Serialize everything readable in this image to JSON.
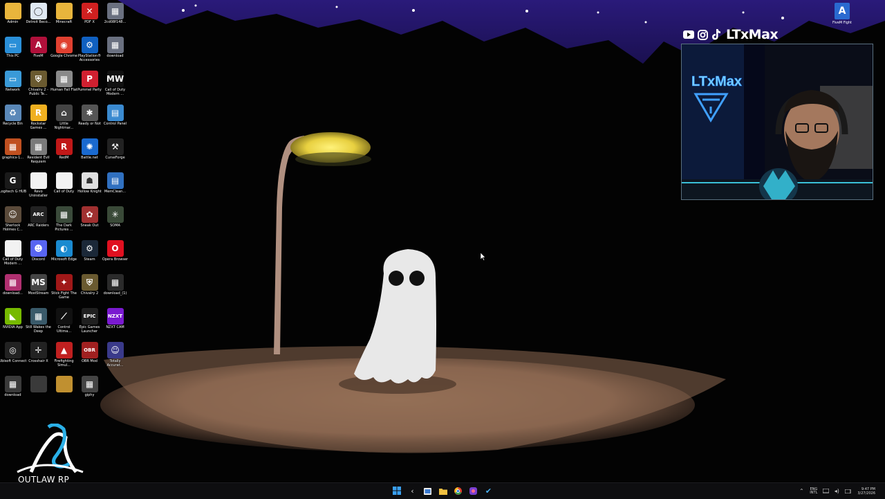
{
  "desktop": {
    "icons": [
      {
        "label": "Admin",
        "icon": "folder-icon",
        "color": "#e8b53c",
        "glyph": ""
      },
      {
        "label": "Detroit Beco...",
        "icon": "detroit-icon",
        "color": "#dfe8f2",
        "glyph": "◯"
      },
      {
        "label": "Minecraft",
        "icon": "folder-icon",
        "color": "#e8b53c",
        "glyph": ""
      },
      {
        "label": "PDF X",
        "icon": "pdf-icon",
        "color": "#d02020",
        "glyph": "✕"
      },
      {
        "label": "2cd08f148...",
        "icon": "image-file-icon",
        "color": "#6a7080",
        "glyph": "▦"
      },
      {
        "label": "This PC",
        "icon": "this-pc-icon",
        "color": "#2a8fd8",
        "glyph": "▭"
      },
      {
        "label": "FiveM",
        "icon": "fivem-icon",
        "color": "#b0103a",
        "glyph": "A"
      },
      {
        "label": "Google Chrome",
        "icon": "chrome-icon",
        "color": "#e04030",
        "glyph": "◉"
      },
      {
        "label": "PlayStation® Accessories",
        "icon": "playstation-icon",
        "color": "#1060c0",
        "glyph": "⚙"
      },
      {
        "label": "download",
        "icon": "image-file-icon",
        "color": "#6a7080",
        "glyph": "▦"
      },
      {
        "label": "Network",
        "icon": "network-icon",
        "color": "#3a9ad8",
        "glyph": "▭"
      },
      {
        "label": "Chivalry 2 - Public Te...",
        "icon": "chivalry-icon",
        "color": "#6a5a30",
        "glyph": "⛨"
      },
      {
        "label": "Human Fall Flat",
        "icon": "human-fall-flat-icon",
        "color": "#8a8a8a",
        "glyph": "▦"
      },
      {
        "label": "Pummel Party",
        "icon": "pummel-party-icon",
        "color": "#d02030",
        "glyph": "P"
      },
      {
        "label": "Call of Duty Modern ...",
        "icon": "mw-icon",
        "color": "#111111",
        "glyph": "MW"
      },
      {
        "label": "Recycle Bin",
        "icon": "recycle-bin-icon",
        "color": "#5a88b8",
        "glyph": "♻"
      },
      {
        "label": "Rockstar Games ...",
        "icon": "rockstar-icon",
        "color": "#f0b020",
        "glyph": "R"
      },
      {
        "label": "Little Nightmar...",
        "icon": "little-nightmares-icon",
        "color": "#444444",
        "glyph": "⌂"
      },
      {
        "label": "Ready or Not",
        "icon": "ready-or-not-icon",
        "color": "#555555",
        "glyph": "✱"
      },
      {
        "label": "Control Panel",
        "icon": "control-panel-icon",
        "color": "#3a8ad0",
        "glyph": "▤"
      },
      {
        "label": "graphics-1...",
        "icon": "image-file-icon",
        "color": "#c05020",
        "glyph": "▦"
      },
      {
        "label": "Resident Evil Requiem",
        "icon": "resident-evil-icon",
        "color": "#7a7a7a",
        "glyph": "▦"
      },
      {
        "label": "RedM",
        "icon": "redm-icon",
        "color": "#c01818",
        "glyph": "R"
      },
      {
        "label": "Battle.net",
        "icon": "battlenet-icon",
        "color": "#1a6ad0",
        "glyph": "✺"
      },
      {
        "label": "CurseForge",
        "icon": "curseforge-icon",
        "color": "#222222",
        "glyph": "⚒"
      },
      {
        "label": "Logitech G HUB",
        "icon": "logitech-icon",
        "color": "#1a1a1a",
        "glyph": "G"
      },
      {
        "label": "Revo Uninstaller",
        "icon": "file-icon",
        "color": "#f2f2f2",
        "glyph": ""
      },
      {
        "label": "Call of Duty",
        "icon": "file-icon",
        "color": "#f2f2f2",
        "glyph": ""
      },
      {
        "label": "Hollow Knight",
        "icon": "hollow-knight-icon",
        "color": "#e0e0e0",
        "glyph": "☗"
      },
      {
        "label": "MemClean...",
        "icon": "memclean-icon",
        "color": "#3070c0",
        "glyph": "▤"
      },
      {
        "label": "Sherlock Holmes C...",
        "icon": "sherlock-icon",
        "color": "#5a4a3a",
        "glyph": "☺"
      },
      {
        "label": "ARC Raiders",
        "icon": "arc-raiders-icon",
        "color": "#222222",
        "glyph": "ARC"
      },
      {
        "label": "The Dark Pictures ...",
        "icon": "dark-pictures-icon",
        "color": "#3a4a3a",
        "glyph": "▦"
      },
      {
        "label": "Sneak Out",
        "icon": "sneak-out-icon",
        "color": "#a03030",
        "glyph": "✿"
      },
      {
        "label": "SOMA",
        "icon": "soma-icon",
        "color": "#3a4a38",
        "glyph": "✳"
      },
      {
        "label": "Call of Duty Modern ...",
        "icon": "file-icon",
        "color": "#f2f2f2",
        "glyph": ""
      },
      {
        "label": "Discord",
        "icon": "discord-icon",
        "color": "#5865f2",
        "glyph": "☻"
      },
      {
        "label": "Microsoft Edge",
        "icon": "edge-icon",
        "color": "#1a8ad0",
        "glyph": "◐"
      },
      {
        "label": "Steam",
        "icon": "steam-icon",
        "color": "#1b2838",
        "glyph": "⚙"
      },
      {
        "label": "Opera Browser",
        "icon": "opera-icon",
        "color": "#e01020",
        "glyph": "O"
      },
      {
        "label": "download...",
        "icon": "image-file-icon",
        "color": "#b03070",
        "glyph": "▦"
      },
      {
        "label": "MostStream",
        "icon": "moststream-icon",
        "color": "#444444",
        "glyph": "MS"
      },
      {
        "label": "Stick Fight The Game",
        "icon": "stick-fight-icon",
        "color": "#a01818",
        "glyph": "✦"
      },
      {
        "label": "Chivalry 2",
        "icon": "chivalry-icon",
        "color": "#6a5a30",
        "glyph": "⛨"
      },
      {
        "label": "download_(1)",
        "icon": "image-file-icon",
        "color": "#2a2a2a",
        "glyph": "▦"
      },
      {
        "label": "NVIDIA App",
        "icon": "nvidia-icon",
        "color": "#76b900",
        "glyph": "◣"
      },
      {
        "label": "Still Wakes the Deep",
        "icon": "still-wakes-icon",
        "color": "#3a5a6a",
        "glyph": "▦"
      },
      {
        "label": "Control Ultima...",
        "icon": "control-icon",
        "color": "#111111",
        "glyph": "⟋"
      },
      {
        "label": "Epic Games Launcher",
        "icon": "epic-games-icon",
        "color": "#202020",
        "glyph": "EPIC"
      },
      {
        "label": "NZXT CAM",
        "icon": "nzxt-icon",
        "color": "#7a1ad0",
        "glyph": "NZXT"
      },
      {
        "label": "Ubisoft Connect",
        "icon": "ubisoft-icon",
        "color": "#222222",
        "glyph": "◎"
      },
      {
        "label": "Crosshair X",
        "icon": "crosshair-icon",
        "color": "#222222",
        "glyph": "✛"
      },
      {
        "label": "Firefighting Simul...",
        "icon": "firefighting-icon",
        "color": "#c02020",
        "glyph": "▲"
      },
      {
        "label": "OBR Mod",
        "icon": "obr-icon",
        "color": "#a02020",
        "glyph": "OBR"
      },
      {
        "label": "Totally Accurat...",
        "icon": "tabs-icon",
        "color": "#3a3a8a",
        "glyph": "☺"
      },
      {
        "label": "download",
        "icon": "image-file-icon",
        "color": "#3a3a3a",
        "glyph": "▦"
      },
      {
        "label": "",
        "icon": "image-file-icon",
        "color": "#3a3a3a",
        "glyph": ""
      },
      {
        "label": "",
        "icon": "image-file-icon",
        "color": "#c09030",
        "glyph": ""
      },
      {
        "label": "giphy",
        "icon": "image-file-icon",
        "color": "#444444",
        "glyph": "▦"
      }
    ],
    "top_right_icon": {
      "label": "FiveM Fight",
      "color": "#2a6ad0"
    }
  },
  "overlay": {
    "handle": "LTxMax",
    "social_icons": [
      "youtube-icon",
      "instagram-icon",
      "tiktok-icon"
    ],
    "cam_sign_text": "LTxMax",
    "brand_logo_text": "OUTLAW RP"
  },
  "taskbar": {
    "buttons": [
      {
        "name": "start-button",
        "icon": "windows-logo-icon"
      },
      {
        "name": "back-button",
        "icon": "back-arrow-icon"
      },
      {
        "name": "taskbar-app-1",
        "icon": "file-explorer-icon"
      },
      {
        "name": "taskbar-app-2",
        "icon": "folder-icon"
      },
      {
        "name": "taskbar-chrome",
        "icon": "chrome-icon"
      },
      {
        "name": "taskbar-app-3",
        "icon": "app-icon"
      },
      {
        "name": "taskbar-app-4",
        "icon": "checkmark-icon"
      }
    ],
    "language": {
      "line1": "ENG",
      "line2": "INTL"
    },
    "clock": {
      "time": "9:47 PM",
      "date": "3/27/2026"
    }
  }
}
